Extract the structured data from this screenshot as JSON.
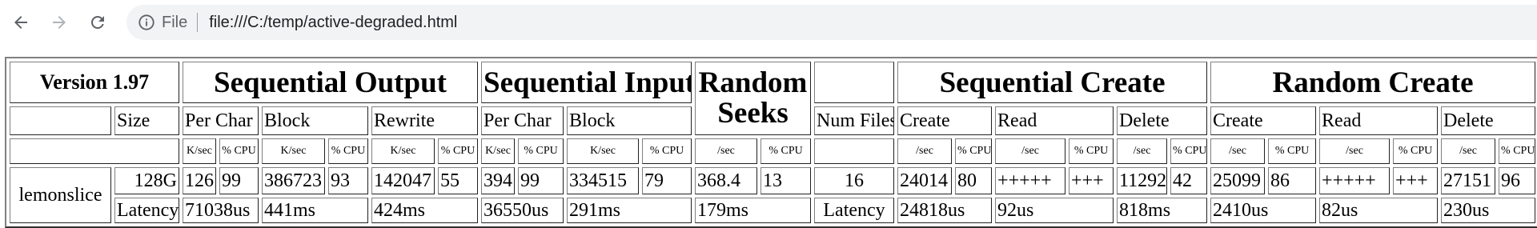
{
  "browser": {
    "scheme_label": "File",
    "url": "file:///C:/temp/active-degraded.html"
  },
  "report": {
    "version": "Version 1.97",
    "groups": {
      "seq_output": "Sequential Output",
      "seq_input": "Sequential Input",
      "random_seeks": "Random Seeks",
      "seq_create": "Sequential Create",
      "random_create": "Random Create"
    },
    "subheaders": {
      "size": "Size",
      "out_per_char": "Per Char",
      "out_block": "Block",
      "out_rewrite": "Rewrite",
      "in_per_char": "Per Char",
      "in_block": "Block",
      "num_files": "Num Files",
      "sc_create": "Create",
      "sc_read": "Read",
      "sc_delete": "Delete",
      "rc_create": "Create",
      "rc_read": "Read",
      "rc_delete": "Delete"
    },
    "units": [
      "K/sec",
      "% CPU",
      "K/sec",
      "% CPU",
      "K/sec",
      "% CPU",
      "K/sec",
      "% CPU",
      "K/sec",
      "% CPU",
      "/sec",
      "% CPU",
      "/sec",
      "% CPU",
      "/sec",
      "% CPU",
      "/sec",
      "% CPU",
      "/sec",
      "% CPU",
      "/sec",
      "% CPU",
      "/sec",
      "% CPU"
    ],
    "machine": "lemonslice",
    "size": "128G",
    "values": [
      "126",
      "99",
      "386723",
      "93",
      "142047",
      "55",
      "394",
      "99",
      "334515",
      "79",
      "368.4",
      "13"
    ],
    "num_files": "16",
    "create_values": [
      "24014",
      "80",
      "+++++",
      "+++",
      "11292",
      "42",
      "25099",
      "86",
      "+++++",
      "+++",
      "27151",
      "96"
    ],
    "latency_label": "Latency",
    "latency_values": [
      "71038us",
      "441ms",
      "424ms",
      "36550us",
      "291ms",
      "179ms"
    ],
    "create_latency_label": "Latency",
    "create_latency_values": [
      "24818us",
      "92us",
      "818ms",
      "2410us",
      "82us",
      "230us"
    ]
  }
}
